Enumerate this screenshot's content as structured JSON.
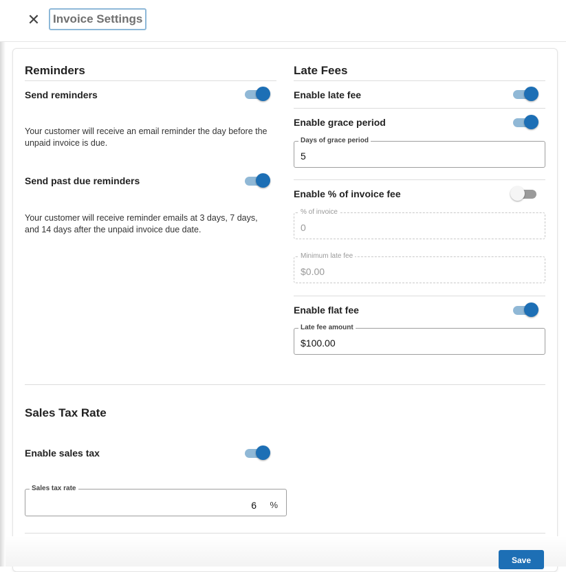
{
  "header": {
    "title": "Invoice Settings",
    "close_icon": "close-icon"
  },
  "reminders": {
    "title": "Reminders",
    "send_reminders": {
      "label": "Send reminders",
      "enabled": true,
      "description": "Your customer will receive an email reminder the day before the unpaid invoice is due."
    },
    "send_past_due": {
      "label": "Send past due reminders",
      "enabled": true,
      "description": "Your customer will receive reminder emails at 3 days, 7 days, and 14 days after the unpaid invoice due date."
    }
  },
  "late_fees": {
    "title": "Late Fees",
    "enable_late_fee": {
      "label": "Enable late fee",
      "enabled": true
    },
    "grace_period": {
      "label": "Enable grace period",
      "enabled": true,
      "field_label": "Days of grace period",
      "value": "5"
    },
    "percent_fee": {
      "label": "Enable % of invoice fee",
      "enabled": false,
      "percent_label": "% of invoice",
      "percent_value": "0",
      "min_label": "Minimum late fee",
      "min_value": "$0.00"
    },
    "flat_fee": {
      "label": "Enable flat fee",
      "enabled": true,
      "field_label": "Late fee amount",
      "value": "$100.00"
    }
  },
  "sales_tax": {
    "title": "Sales Tax Rate",
    "enable_label": "Enable sales tax",
    "enabled": true,
    "field_label": "Sales tax rate",
    "value": "6",
    "unit": "%"
  },
  "footer": {
    "save_label": "Save"
  },
  "colors": {
    "accent": "#1d6fb5",
    "toggle_track_on": "#90b8d6"
  }
}
